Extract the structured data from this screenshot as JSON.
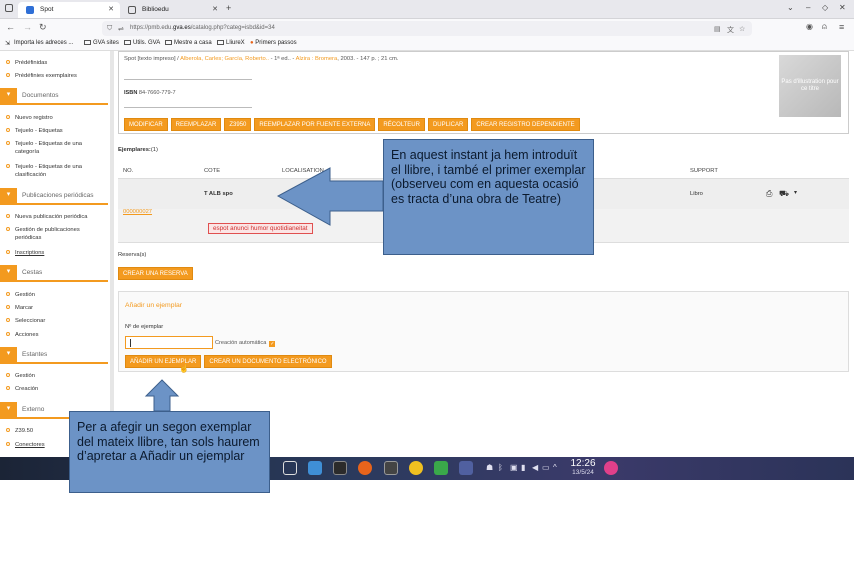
{
  "browser": {
    "tabs": [
      {
        "label": "Spot",
        "active": true,
        "icon": "pmb-favicon"
      },
      {
        "label": "Biblioedu",
        "active": false,
        "icon": "document-icon"
      }
    ],
    "url_prefix": "https://pmb.edu.",
    "url_domain": "gva.es",
    "url_path": "/catalog.php?categ=isbd&id=34",
    "bookmarks": [
      {
        "label": "Importa les adreces ..."
      },
      {
        "label": "GVA sites"
      },
      {
        "label": "Utils. GVA"
      },
      {
        "label": "Mestre a casa"
      },
      {
        "label": "LliureX"
      },
      {
        "label": "Primers passos"
      }
    ]
  },
  "sidebar": {
    "top_items": [
      "Prédéfinidas",
      "Prédéfinies exemplaires"
    ],
    "sections": [
      {
        "title": "Documentos",
        "items": [
          "Nuevo registro",
          "Tejuelo - Etiquetas",
          "Tejuelo - Etiquetas de una categoría",
          "Tejuelo - Etiquetas de una clasificación"
        ]
      },
      {
        "title": "Publicaciones periódicas",
        "items": [
          "Nueva publicación periódica",
          "Gestión de publicaciones periódicas",
          "Inscriptions"
        ]
      },
      {
        "title": "Cestas",
        "items": [
          "Gestión",
          "Marcar",
          "Seleccionar",
          "Acciones"
        ]
      },
      {
        "title": "Estantes",
        "items": [
          "Gestión",
          "Creación"
        ]
      },
      {
        "title": "Externo",
        "items": [
          "Z39.50",
          "Conectores"
        ]
      }
    ]
  },
  "record": {
    "description_start": "Spot [texto impreso] / ",
    "authors": "Alberola, Carles; García, Roberto..",
    "edition": " - 1ª ed.. - ",
    "publisher": "Alzira : Bromera",
    "details": ", 2003. - 147 p. ; 21 cm.",
    "isbn_label": "ISBN",
    "isbn_value": " 84-7660-779-7",
    "cover_placeholder": "Pas d'illustration pour ce titre",
    "actions": [
      "MODIFICAR",
      "REEMPLAZAR",
      "Z3950",
      "REEMPLAZAR POR FUENTE EXTERNA",
      "RÉCOLTEUR",
      "DUPLICAR",
      "CREAR REGISTRO DEPENDIENTE"
    ]
  },
  "copies": {
    "label": "Ejemplares:",
    "count": "(1)",
    "columns": [
      "NO.",
      "COTE",
      "LOCALISATION",
      "SUPPORT"
    ],
    "row": {
      "cote": "T ALB spo",
      "support": "Libro"
    },
    "barcode": "000000027",
    "note": "espot anunci humor quotidianeitat"
  },
  "reservations": {
    "label": "Reserva(s)",
    "button": "CREAR UNA RESERVA"
  },
  "add_copy": {
    "title": "Añadir un ejemplar",
    "field_label": "Nº de ejemplar",
    "auto_label": "Creación automática",
    "auto_checked": true,
    "buttons": [
      "AÑADIR UN EJEMPLAR",
      "CREAR UN DOCUMENTO ELECTRÓNICO"
    ]
  },
  "taskbar": {
    "time": "12:26",
    "date": "13/5/24"
  },
  "annotations": {
    "callout_top": "En aquest instant ja hem introduït el llibre, i també el primer exemplar (observeu com en aquesta ocasió es tracta d’una obra de Teatre)",
    "callout_bottom": "Per a afegir un segon exemplar del mateix llibre, tan sols haurem d’apretar a Añadir un ejemplar"
  },
  "colors": {
    "accent": "#f39a1f",
    "callout": "#6c93c6",
    "note_red": "#d03030"
  }
}
